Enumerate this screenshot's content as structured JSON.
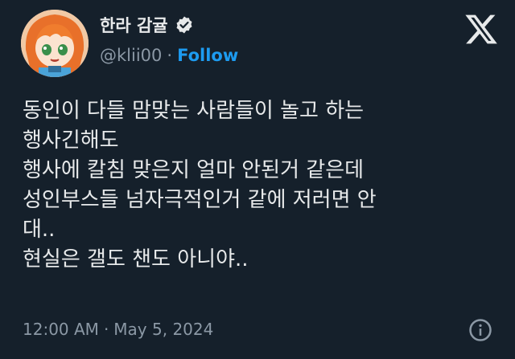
{
  "colors": {
    "background": "#15202b",
    "text": "#e7e9ea",
    "secondary": "#8b98a5",
    "accent": "#1d9bf0"
  },
  "author": {
    "display_name": "한라 감귤",
    "handle": "@klii00",
    "separator": "·",
    "follow_label": "Follow",
    "verified_icon": "verified-badge-icon",
    "avatar": "anime-character-avatar"
  },
  "platform_icon": "x-logo-icon",
  "tweet": {
    "lines": [
      "동인이 다들 맘맞는 사람들이 놀고 하는",
      "행사긴해도",
      "행사에 칼침 맞은지 얼마 안된거 같은데",
      "성인부스들 넘자극적인거 같에 저러면 안",
      "대..",
      "현실은 갤도 챈도 아니야.."
    ]
  },
  "meta": {
    "time": "12:00 AM",
    "separator": "·",
    "date": "May 5, 2024"
  },
  "info_icon": "info-icon"
}
